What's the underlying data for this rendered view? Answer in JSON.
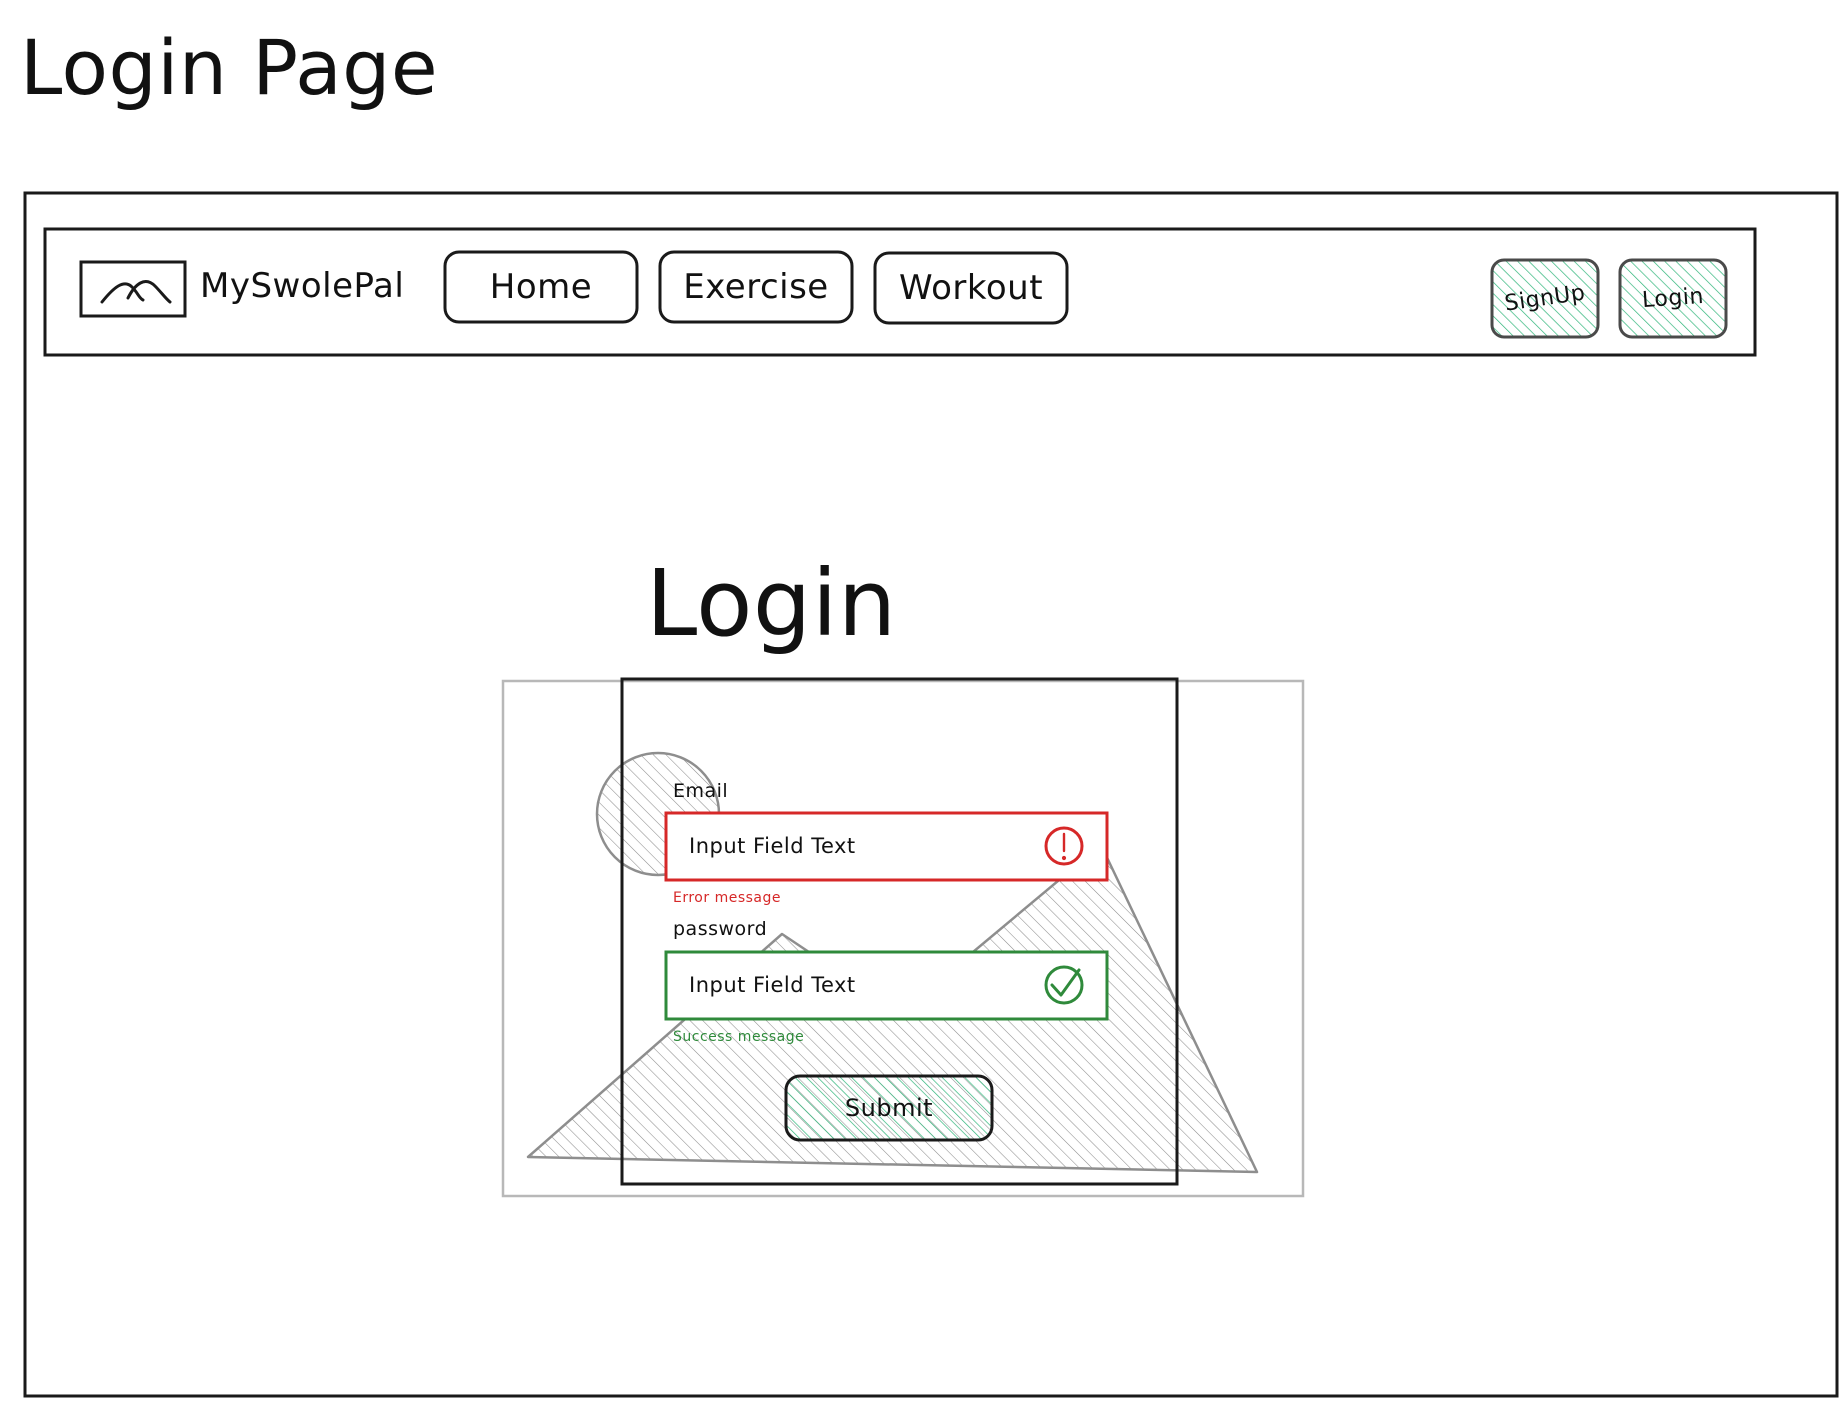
{
  "page_title": "Login Page",
  "brand": {
    "name": "MySwolePal",
    "logo_icon": "image-placeholder-icon"
  },
  "nav": {
    "items": [
      {
        "label": "Home"
      },
      {
        "label": "Exercise"
      },
      {
        "label": "Workout"
      }
    ],
    "auth_buttons": [
      {
        "label": "SignUp"
      },
      {
        "label": "Login"
      }
    ]
  },
  "login_form": {
    "heading": "Login",
    "email": {
      "label": "Email",
      "value": "Input Field Text",
      "state_icon": "error-icon",
      "message": "Error message"
    },
    "password": {
      "label": "password",
      "value": "Input Field Text",
      "state_icon": "check-circle-icon",
      "message": "Success message"
    },
    "submit_label": "Submit"
  },
  "colors": {
    "ink": "#111111",
    "error": "#d62828",
    "success": "#2f8a3b",
    "accent_hatch": "#2fb57a",
    "hatch_gray": "#9a9a9a"
  }
}
